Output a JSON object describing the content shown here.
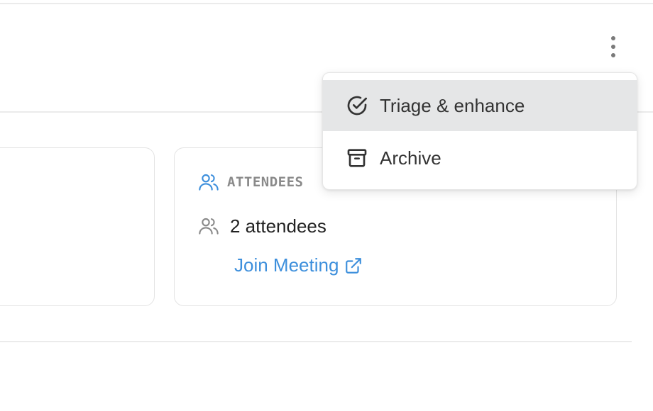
{
  "header": {
    "more_icon": "more-vertical-icon"
  },
  "attendees_card": {
    "section_title": "ATTENDEES",
    "section_icon": "users-icon",
    "count_icon": "users-icon",
    "count_label": "2 attendees",
    "join_link_label": "Join Meeting",
    "join_link_icon": "external-link-icon",
    "accent_color": "#3d8fdc"
  },
  "menu": {
    "items": [
      {
        "label": "Triage & enhance",
        "icon": "check-circle-icon",
        "active": true
      },
      {
        "label": "Archive",
        "icon": "archive-icon",
        "active": false
      }
    ]
  }
}
